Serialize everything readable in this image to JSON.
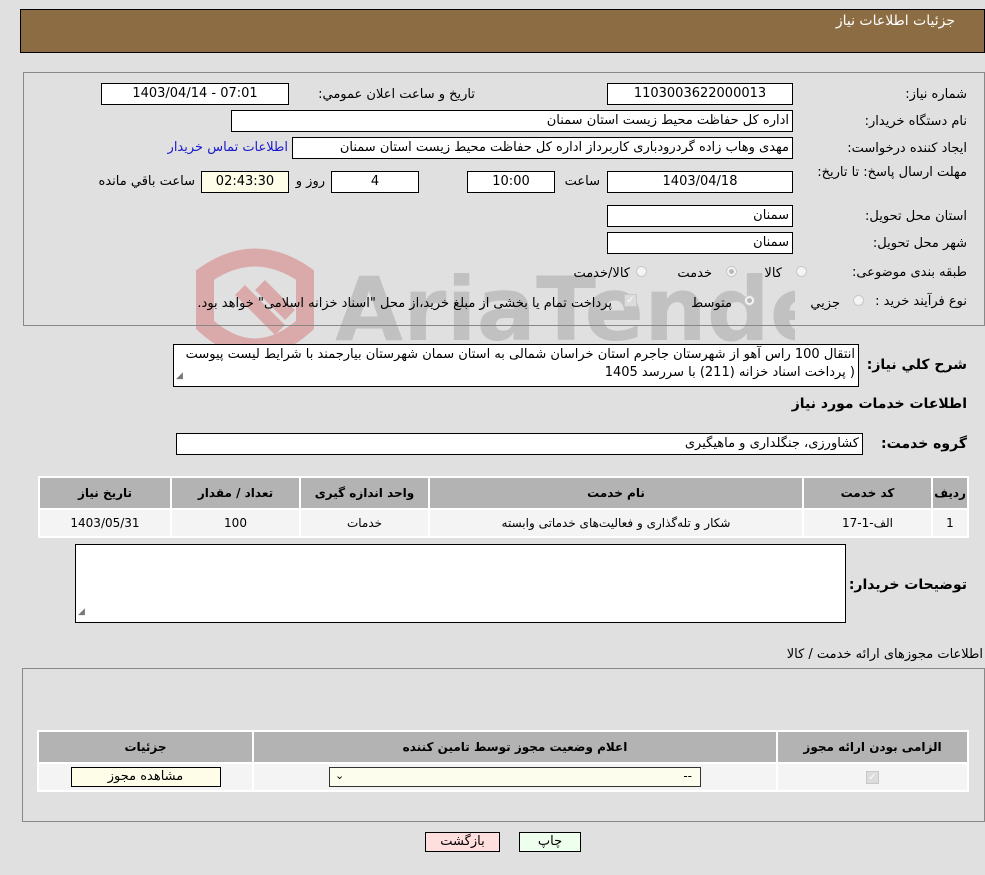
{
  "header": {
    "title": "جزئیات اطلاعات نیاز"
  },
  "form": {
    "need_number": {
      "label": "شماره نیاز:",
      "value": "1103003622000013"
    },
    "announce_datetime": {
      "label": "تاریخ و ساعت اعلان عمومي:",
      "value": "1403/04/14 - 07:01"
    },
    "buyer_org": {
      "label": "نام دستگاه خریدار:",
      "value": "اداره کل حفاظت محیط زیست استان سمنان"
    },
    "requester": {
      "label": "ایجاد کننده درخواست:",
      "value": "مهدی وهاب زاده گردرودباری کاربرداز اداره کل حفاظت محیط زیست استان سمنان"
    },
    "buyer_contact_link": "اطلاعات تماس خریدار",
    "deadline": {
      "label": "مهلت ارسال پاسخ: تا تاریخ:",
      "date": "1403/04/18",
      "time_label": "ساعت",
      "time": "10:00",
      "days": "4",
      "days_label": "روز و",
      "remaining": "02:43:30",
      "remaining_label": "ساعت باقي مانده"
    },
    "delivery_province": {
      "label": "استان محل تحویل:",
      "value": "سمنان"
    },
    "delivery_city": {
      "label": "شهر محل تحویل:",
      "value": "سمنان"
    },
    "category": {
      "label": "طبقه بندی موضوعی:",
      "options": [
        "کالا",
        "خدمت",
        "کالا/خدمت"
      ],
      "selected": "خدمت"
    },
    "purchase_type": {
      "label": "نوع فرآیند خرید :",
      "options": [
        "جزيي",
        "متوسط"
      ],
      "selected": "متوسط",
      "treasury_note": "پرداخت تمام یا بخشی از مبلغ خرید،از محل \"اسناد خزانه اسلامی\" خواهد بود.",
      "treasury_checked": true
    }
  },
  "description": {
    "label": "شرح کلي نیاز:",
    "value": "انتقال 100 راس آهو از شهرستان جاجرم  استان خراسان شمالی به استان سمان شهرستان بیارجمند با شرایط لیست پیوست ( پرداخت اسناد خزانه (211) با سررسد 1405"
  },
  "services_section": {
    "title": "اطلاعات خدمات مورد نیاز",
    "group_label": "گروه خدمت:",
    "group_value": "کشاورزی، جنگلداری و ماهیگیری",
    "table": {
      "headers": [
        "ردیف",
        "کد خدمت",
        "نام خدمت",
        "واحد اندازه گیری",
        "تعداد / مقدار",
        "تاریخ نیاز"
      ],
      "rows": [
        [
          "1",
          "الف-1-17",
          "شکار و تله‌گذاری و فعالیت‌های خدماتی وابسته",
          "خدمات",
          "100",
          "1403/05/31"
        ]
      ]
    },
    "buyer_notes_label": "توضیحات خریدار:",
    "buyer_notes_value": ""
  },
  "permits_section": {
    "title": "اطلاعات مجوزهای ارائه خدمت / کالا",
    "headers": [
      "الزامی بودن ارائه مجوز",
      "اعلام وضعیت مجوز توسط تامین کننده",
      "جزئیات"
    ],
    "row": {
      "required_checked": true,
      "status_selected": "--",
      "details_button": "مشاهده مجوز"
    }
  },
  "buttons": {
    "back": "بازگشت",
    "print": "چاپ"
  },
  "colors": {
    "header_bg": "#8c6c42",
    "back_bg": "#ffdede",
    "print_bg": "#eeffee",
    "link": "#1a1acc"
  }
}
